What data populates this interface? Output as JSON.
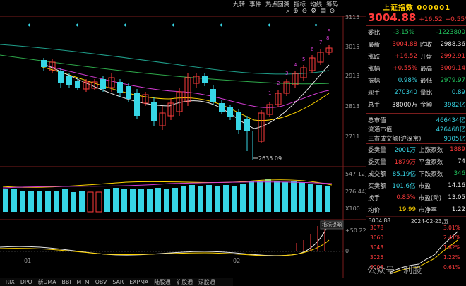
{
  "toolbar": {
    "items": [
      "九转",
      "事件",
      "热点回溯",
      "指标",
      "均线",
      "筹码"
    ],
    "icons": [
      "search-icon",
      "zoom-in-icon",
      "zoom-out-icon",
      "gear-icon",
      "chart-icon",
      "settings-icon"
    ]
  },
  "main_chart": {
    "y_axis": [
      "3115",
      "3015",
      "2913",
      "2813",
      "2711"
    ],
    "low_label": "2635.09",
    "nine_labels": [
      "1",
      "2",
      "3",
      "4",
      "5",
      "6",
      "7",
      "8",
      "9"
    ],
    "volume_axis": [
      "547.12万",
      "276.44万",
      "X100"
    ],
    "macd_axis": [
      "+50.22",
      "0"
    ],
    "macd_label": "指标说明",
    "x_labels": [
      "01",
      "02"
    ]
  },
  "panel": {
    "title": "上证指数 000001",
    "price": "3004.88",
    "change": "+16.52",
    "change_pct": "+0.55%",
    "rows": [
      {
        "k": "委比",
        "v": "-3.15%",
        "vc": "green",
        "k2": "",
        "v2": "-1223800",
        "v2c": "green"
      },
      {
        "k": "最新",
        "v": "3004.88",
        "vc": "red",
        "k2": "昨收",
        "v2": "2988.36",
        "v2c": "white"
      },
      {
        "k": "涨跌",
        "v": "+16.52",
        "vc": "red",
        "k2": "开盘",
        "v2": "2992.91",
        "v2c": "red"
      },
      {
        "k": "涨幅",
        "v": "+0.55%",
        "vc": "red",
        "k2": "最高",
        "v2": "3009.14",
        "v2c": "red"
      },
      {
        "k": "振幅",
        "v": "0.98%",
        "vc": "cyan",
        "k2": "最低",
        "v2": "2979.97",
        "v2c": "green"
      },
      {
        "k": "现手",
        "v": "270340",
        "vc": "cyan",
        "k2": "量比",
        "v2": "0.89",
        "v2c": "cyan"
      },
      {
        "k": "总手",
        "v": "38000万",
        "vc": "white",
        "k2": "金额",
        "v2": "3982亿",
        "v2c": "cyan"
      }
    ],
    "market": [
      {
        "k": "总市值",
        "v": "466434亿",
        "vc": "cyan"
      },
      {
        "k": "流通市值",
        "v": "426468亿",
        "vc": "cyan"
      },
      {
        "k": "三市成交额(沪深京)",
        "v": "9305亿",
        "vc": "cyan"
      }
    ],
    "stats": [
      {
        "k": "委卖量",
        "v": "2001万",
        "vc": "cyan",
        "k2": "上涨家数",
        "v2": "1889",
        "v2c": "red"
      },
      {
        "k": "委买量",
        "v": "1879万",
        "vc": "red",
        "k2": "平盘家数",
        "v2": "74",
        "v2c": "white"
      },
      {
        "k": "成交额",
        "v": "85.19亿",
        "vc": "cyan",
        "k2": "下跌家数",
        "v2": "346",
        "v2c": "green"
      },
      {
        "k": "买卖额",
        "v": "101.6亿",
        "vc": "cyan",
        "k2": "市盈",
        "v2": "14.16",
        "v2c": "white"
      },
      {
        "k": "换手",
        "v": "0.85%",
        "vc": "red",
        "k2": "市盈(动)",
        "v2": "13.05",
        "v2c": "white"
      },
      {
        "k": "均价",
        "v": "19.99",
        "vc": "yellow",
        "k2": "市净率",
        "v2": "1.22",
        "v2c": "white"
      }
    ]
  },
  "mini_chart": {
    "price": "3004.88",
    "date": "2024-02-23,五",
    "y_left": [
      "3078",
      "3060",
      "3043",
      "3025",
      "3008"
    ],
    "y_right": [
      "3.01%",
      "2.41%",
      "1.82%",
      "1.22%",
      "0.61%"
    ]
  },
  "tabs": [
    "TRIX",
    "DPO",
    "新DMA",
    "BBI",
    "MTM",
    "OBV",
    "SAR",
    "EXPMA",
    "陆股通",
    "沪股通",
    "深股通"
  ],
  "watermark": "公众号 · 利股"
}
